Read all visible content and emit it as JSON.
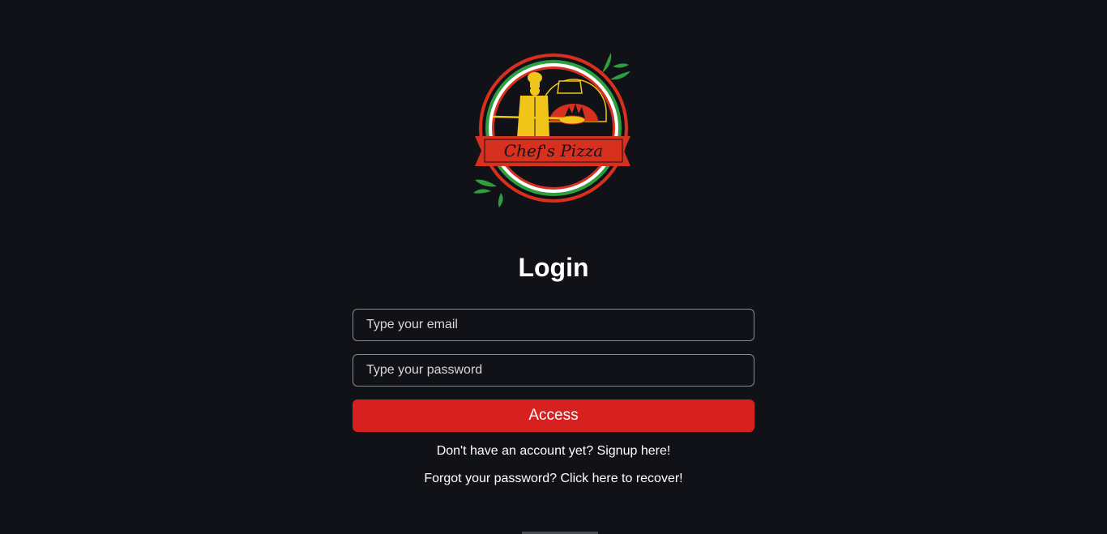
{
  "logo": {
    "name": "Chef's Pizza",
    "colors": {
      "red": "#d7301f",
      "green": "#2e9e3e",
      "yellow": "#f0c419",
      "white": "#ffffff"
    }
  },
  "login": {
    "title": "Login",
    "email_placeholder": "Type your email",
    "password_placeholder": "Type your password",
    "submit_label": "Access",
    "signup_text": "Don't have an account yet? Signup here!",
    "recover_text": "Forgot your password? Click here to recover!"
  },
  "theme": {
    "background": "#111217",
    "accent": "#d72121"
  }
}
